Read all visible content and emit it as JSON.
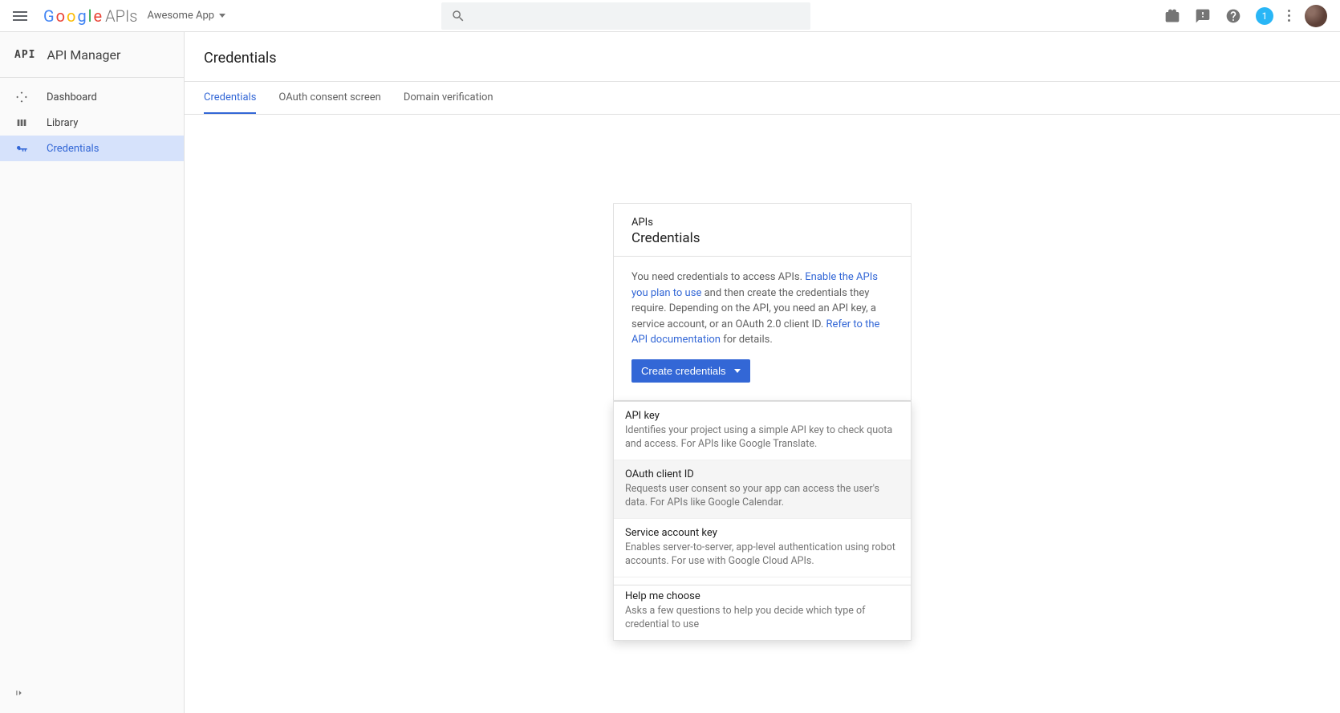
{
  "brand": {
    "google": "Google",
    "apis": "APIs"
  },
  "project_name": "Awesome App",
  "notif_count": "1",
  "sidebar": {
    "badge": "API",
    "title": "API Manager",
    "items": [
      {
        "label": "Dashboard",
        "icon": "dashboard-icon"
      },
      {
        "label": "Library",
        "icon": "library-icon"
      },
      {
        "label": "Credentials",
        "icon": "key-icon",
        "active": true
      }
    ]
  },
  "page_title": "Credentials",
  "tabs": [
    {
      "label": "Credentials",
      "active": true
    },
    {
      "label": "OAuth consent screen"
    },
    {
      "label": "Domain verification"
    }
  ],
  "card": {
    "eyebrow": "APIs",
    "title": "Credentials",
    "text_pre": "You need credentials to access APIs. ",
    "link1": "Enable the APIs you plan to use",
    "text_mid": " and then create the credentials they require. Depending on the API, you need an API key, a service account, or an OAuth 2.0 client ID. ",
    "link2": "Refer to the API documentation",
    "text_post": " for details.",
    "button": "Create credentials"
  },
  "menu": [
    {
      "title": "API key",
      "desc": "Identifies your project using a simple API key to check quota and access. For APIs like Google Translate."
    },
    {
      "title": "OAuth client ID",
      "desc": "Requests user consent so your app can access the user's data. For APIs like Google Calendar.",
      "hover": true
    },
    {
      "title": "Service account key",
      "desc": "Enables server-to-server, app-level authentication using robot accounts. For use with Google Cloud APIs."
    },
    {
      "title": "Help me choose",
      "desc": "Asks a few questions to help you decide which type of credential to use",
      "separated": true
    }
  ]
}
